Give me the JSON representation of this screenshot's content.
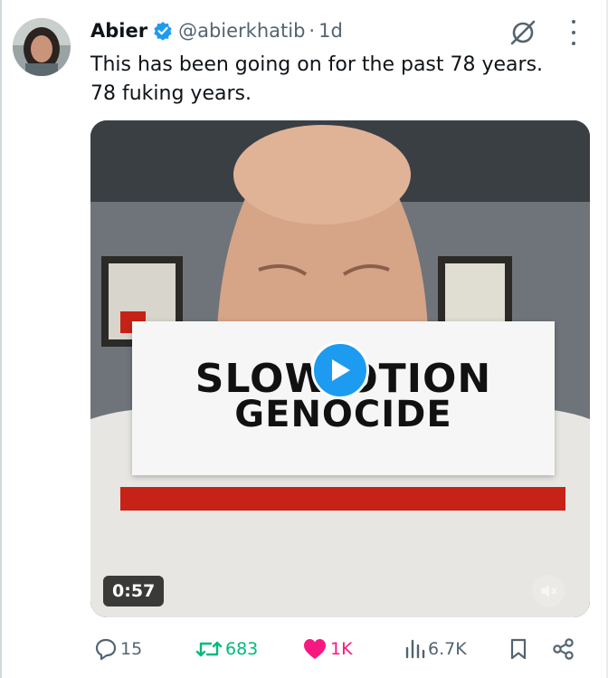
{
  "tweet": {
    "display_name": "Abier",
    "handle": "@abierkhatib",
    "separator": "·",
    "time": "1d",
    "text_lines": [
      "This has been going on for the past 78 years.",
      "78 fuking years."
    ]
  },
  "media": {
    "headline_line1": "SLOW  OTION",
    "headline_line2": "GENOCIDE",
    "duration": "0:57"
  },
  "actions": {
    "replies": "15",
    "reposts": "683",
    "likes": "1K",
    "views": "6.7K"
  },
  "colors": {
    "accent": "#1d9bf0",
    "repost": "#00ba7c",
    "like": "#f91880",
    "banner_red": "#c62217"
  },
  "icons": [
    "verified-badge-icon",
    "grok-icon",
    "more-icon",
    "play-icon",
    "mute-icon",
    "reply-icon",
    "repost-icon",
    "heart-icon",
    "views-icon",
    "bookmark-icon",
    "share-icon"
  ]
}
